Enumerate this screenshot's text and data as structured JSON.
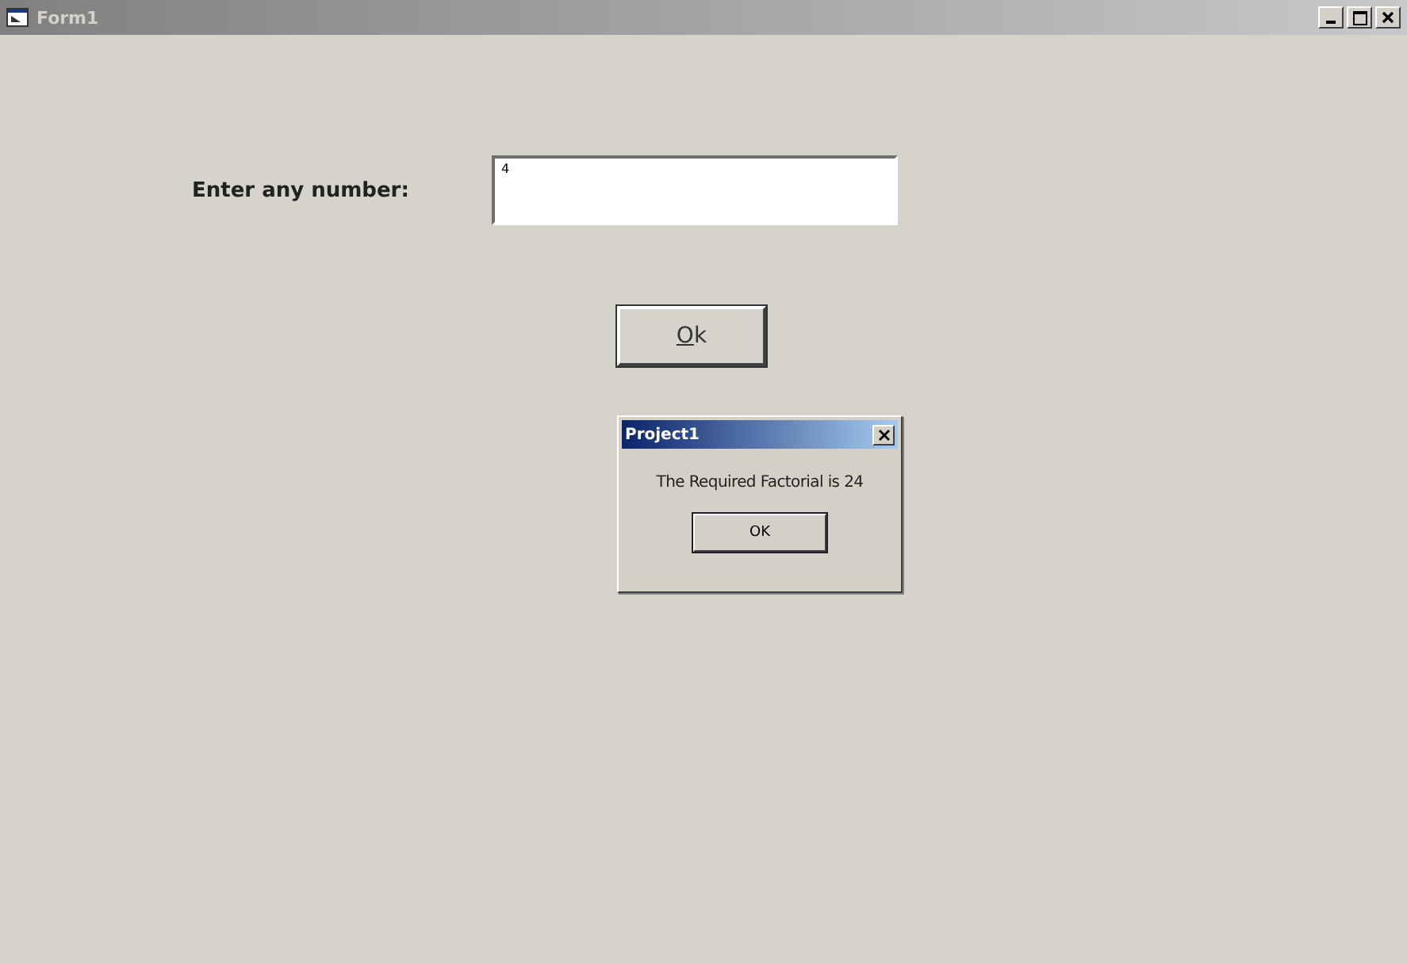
{
  "window": {
    "title": "Form1",
    "inactive": true
  },
  "form": {
    "label": "Enter any number:",
    "input_value": "4",
    "button": {
      "label": "Ok"
    }
  },
  "message_box": {
    "title": "Project1",
    "message": "The Required Factorial is 24",
    "button": "OK"
  }
}
